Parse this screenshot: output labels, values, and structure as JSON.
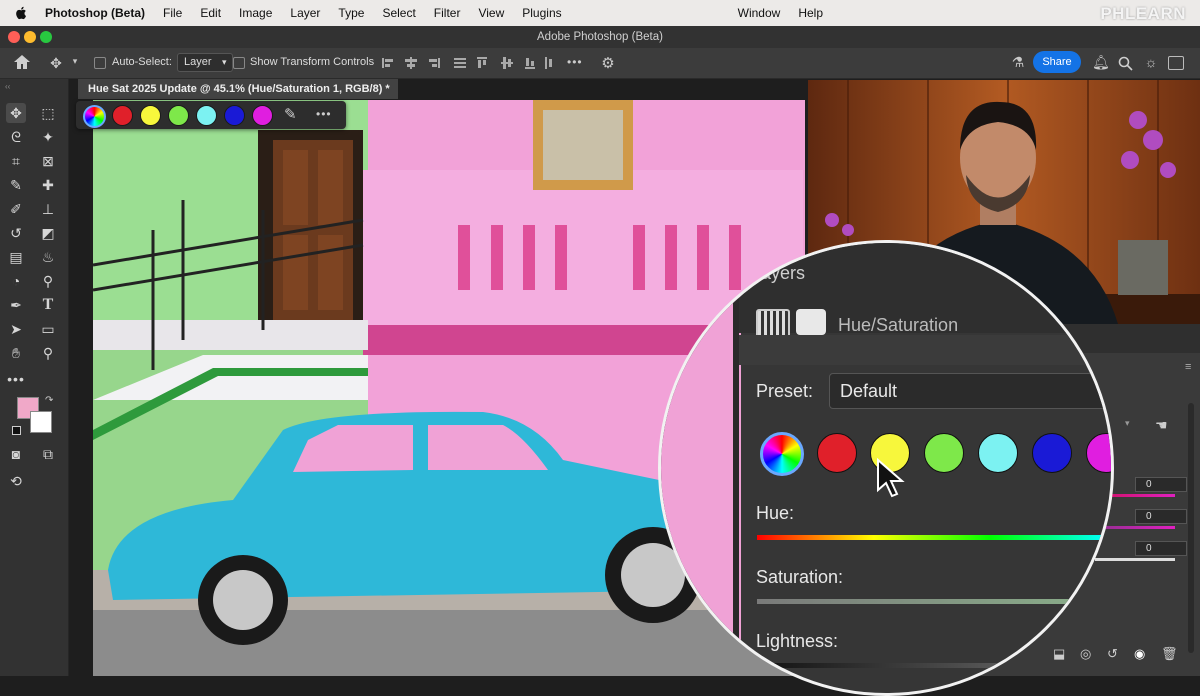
{
  "menubar": {
    "app_name": "Photoshop (Beta)",
    "items": [
      "File",
      "Edit",
      "Image",
      "Layer",
      "Type",
      "Select",
      "Filter",
      "View",
      "Plugins"
    ],
    "right_items": [
      "Window",
      "Help"
    ],
    "watermark": "PHLEARN"
  },
  "window": {
    "title": "Adobe Photoshop (Beta)"
  },
  "options_bar": {
    "auto_select_label": "Auto-Select:",
    "auto_select_value": "Layer",
    "transform_label": "Show Transform Controls",
    "share_label": "Share",
    "more_label": "•••"
  },
  "document": {
    "tab_title": "Hue Sat 2025 Update @ 45.1% (Hue/Saturation 1, RGB/8) *"
  },
  "swatches": {
    "colors": [
      "#e0202a",
      "#f7f73c",
      "#7ee84a",
      "#7cf2f2",
      "#1a1ad6",
      "#e01ee0"
    ],
    "more_label": "•••"
  },
  "colors": {
    "foreground": "#f0a8c8",
    "background": "#ffffff",
    "accent": "#1473e6"
  },
  "panel": {
    "layers_label": "Layers",
    "adjustment_title": "Hue/Saturation",
    "preset_label": "Preset:",
    "preset_value": "Default",
    "hue_label": "Hue:",
    "saturation_label": "Saturation:",
    "lightness_label": "Lightness:",
    "hue_value": "0",
    "saturation_value": "0",
    "lightness_value": "0"
  }
}
